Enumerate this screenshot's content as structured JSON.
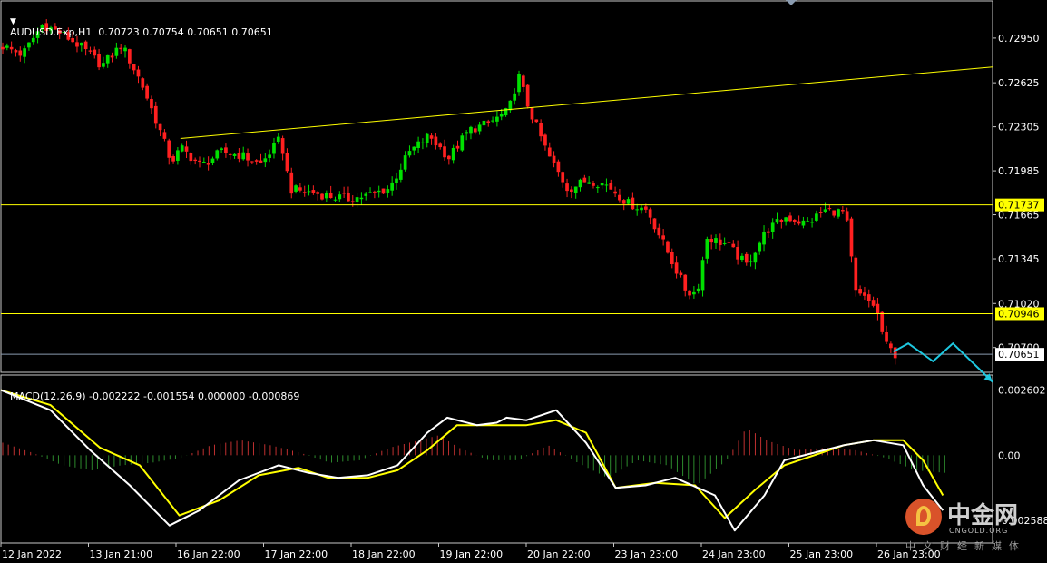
{
  "symbol_header": "AUDUSD.Exp,H1  0.70723 0.70754 0.70651 0.70651",
  "macd_header": "MACD(12,26,9) -0.002222 -0.001554 0.000000 -0.000869",
  "watermark": {
    "name": "中金网",
    "domain": "CNGOLD.ORG",
    "sub": "中文财经新媒体"
  },
  "colors": {
    "bull": "#00e000",
    "bear": "#ff2020",
    "trendline": "#ffff00",
    "forecast": "#1ec8e0",
    "macd_main": "#ffffff",
    "macd_signal": "#ffff00",
    "grid": "#cfcfcf",
    "price_line": "#8a9bb0"
  },
  "chart_data": [
    {
      "type": "candlestick",
      "symbol": "AUDUSD.Exp",
      "timeframe": "H1",
      "ohlc": {
        "open": 0.70723,
        "high": 0.70754,
        "low": 0.70651,
        "close": 0.70651
      },
      "ylim": [
        0.7052,
        0.7322
      ],
      "y_ticks": [
        "0.72950",
        "0.72625",
        "0.72305",
        "0.71985",
        "0.71665",
        "0.71345",
        "0.71020",
        "0.70700"
      ],
      "x_ticks": [
        "12 Jan 2022",
        "13 Jan 21:00",
        "16 Jan 22:00",
        "17 Jan 22:00",
        "18 Jan 22:00",
        "19 Jan 22:00",
        "20 Jan 22:00",
        "23 Jan 23:00",
        "24 Jan 23:00",
        "25 Jan 23:00",
        "26 Jan 23:00"
      ],
      "horizontal_levels": [
        {
          "value": 0.71737,
          "label": "0.71737"
        },
        {
          "value": 0.70946,
          "label": "0.70946"
        }
      ],
      "current_price": {
        "value": 0.70651,
        "label": "0.70651"
      },
      "trendline": {
        "from": [
          0.181,
          0.7222
        ],
        "to": [
          1.0,
          0.7274
        ]
      },
      "close_path": [
        [
          0.0,
          0.7289
        ],
        [
          0.02,
          0.7283
        ],
        [
          0.04,
          0.7305
        ],
        [
          0.06,
          0.7298
        ],
        [
          0.08,
          0.7288
        ],
        [
          0.1,
          0.7275
        ],
        [
          0.12,
          0.729
        ],
        [
          0.14,
          0.7262
        ],
        [
          0.16,
          0.7225
        ],
        [
          0.17,
          0.7205
        ],
        [
          0.18,
          0.7215
        ],
        [
          0.2,
          0.7202
        ],
        [
          0.22,
          0.7212
        ],
        [
          0.24,
          0.721
        ],
        [
          0.26,
          0.7203
        ],
        [
          0.28,
          0.7222
        ],
        [
          0.29,
          0.7185
        ],
        [
          0.31,
          0.7183
        ],
        [
          0.33,
          0.718
        ],
        [
          0.35,
          0.7178
        ],
        [
          0.37,
          0.7181
        ],
        [
          0.39,
          0.7186
        ],
        [
          0.41,
          0.7212
        ],
        [
          0.43,
          0.7224
        ],
        [
          0.45,
          0.7208
        ],
        [
          0.47,
          0.7228
        ],
        [
          0.49,
          0.7233
        ],
        [
          0.51,
          0.7242
        ],
        [
          0.52,
          0.7268
        ],
        [
          0.53,
          0.7245
        ],
        [
          0.55,
          0.721
        ],
        [
          0.57,
          0.7185
        ],
        [
          0.59,
          0.7192
        ],
        [
          0.61,
          0.7188
        ],
        [
          0.63,
          0.7175
        ],
        [
          0.65,
          0.717
        ],
        [
          0.67,
          0.714
        ],
        [
          0.69,
          0.711
        ],
        [
          0.7,
          0.711
        ],
        [
          0.71,
          0.715
        ],
        [
          0.73,
          0.7145
        ],
        [
          0.75,
          0.713
        ],
        [
          0.77,
          0.7155
        ],
        [
          0.79,
          0.7165
        ],
        [
          0.81,
          0.716
        ],
        [
          0.83,
          0.717
        ],
        [
          0.85,
          0.7168
        ],
        [
          0.86,
          0.711
        ],
        [
          0.88,
          0.71
        ],
        [
          0.89,
          0.7072
        ],
        [
          0.9,
          0.70651
        ]
      ],
      "forecast_path": [
        [
          0.9,
          0.7067
        ],
        [
          0.915,
          0.7073
        ],
        [
          0.94,
          0.706
        ],
        [
          0.96,
          0.7073
        ],
        [
          1.0,
          0.7045
        ]
      ]
    },
    {
      "type": "macd",
      "params": "12,26,9",
      "values": {
        "main": -0.002222,
        "signal": -0.001554,
        "histogram": 0.0,
        "osma": -0.000869
      },
      "ylim": [
        -0.0035,
        0.0032
      ],
      "y_ticks": [
        "0.002602",
        "0.00",
        "-0.002588"
      ],
      "main_path": [
        [
          0.0,
          0.0026
        ],
        [
          0.05,
          0.0018
        ],
        [
          0.09,
          0.0002
        ],
        [
          0.13,
          -0.0012
        ],
        [
          0.17,
          -0.0028
        ],
        [
          0.2,
          -0.0022
        ],
        [
          0.24,
          -0.001
        ],
        [
          0.28,
          -0.0004
        ],
        [
          0.31,
          -0.0007
        ],
        [
          0.34,
          -0.0009
        ],
        [
          0.37,
          -0.0008
        ],
        [
          0.4,
          -0.0004
        ],
        [
          0.43,
          0.0009
        ],
        [
          0.45,
          0.0015
        ],
        [
          0.48,
          0.0012
        ],
        [
          0.5,
          0.0013
        ],
        [
          0.51,
          0.0015
        ],
        [
          0.53,
          0.0014
        ],
        [
          0.56,
          0.0018
        ],
        [
          0.59,
          0.0005
        ],
        [
          0.62,
          -0.0013
        ],
        [
          0.65,
          -0.0012
        ],
        [
          0.68,
          -0.0009
        ],
        [
          0.72,
          -0.0016
        ],
        [
          0.74,
          -0.003
        ],
        [
          0.77,
          -0.0016
        ],
        [
          0.79,
          -0.0002
        ],
        [
          0.82,
          0.0001
        ],
        [
          0.85,
          0.0004
        ],
        [
          0.88,
          0.0006
        ],
        [
          0.91,
          0.0004
        ],
        [
          0.93,
          -0.0012
        ],
        [
          0.95,
          -0.0022
        ]
      ],
      "signal_path": [
        [
          0.0,
          0.0026
        ],
        [
          0.05,
          0.002
        ],
        [
          0.1,
          0.0003
        ],
        [
          0.14,
          -0.0004
        ],
        [
          0.18,
          -0.0024
        ],
        [
          0.22,
          -0.0018
        ],
        [
          0.26,
          -0.0008
        ],
        [
          0.3,
          -0.0005
        ],
        [
          0.33,
          -0.0009
        ],
        [
          0.37,
          -0.0009
        ],
        [
          0.4,
          -0.0006
        ],
        [
          0.43,
          0.0002
        ],
        [
          0.46,
          0.0012
        ],
        [
          0.5,
          0.0012
        ],
        [
          0.53,
          0.0012
        ],
        [
          0.56,
          0.0014
        ],
        [
          0.59,
          0.0009
        ],
        [
          0.62,
          -0.0013
        ],
        [
          0.66,
          -0.0011
        ],
        [
          0.7,
          -0.0012
        ],
        [
          0.73,
          -0.0025
        ],
        [
          0.76,
          -0.0014
        ],
        [
          0.79,
          -0.0004
        ],
        [
          0.82,
          0.0
        ],
        [
          0.85,
          0.0004
        ],
        [
          0.88,
          0.0006
        ],
        [
          0.91,
          0.0006
        ],
        [
          0.93,
          -0.0002
        ],
        [
          0.95,
          -0.0016
        ]
      ],
      "histogram_path": [
        [
          0.0,
          0.0005
        ],
        [
          0.03,
          0.0001
        ],
        [
          0.06,
          -0.0004
        ],
        [
          0.09,
          -0.0006
        ],
        [
          0.12,
          -0.0004
        ],
        [
          0.15,
          -0.0003
        ],
        [
          0.18,
          -0.0001
        ],
        [
          0.21,
          0.0004
        ],
        [
          0.24,
          0.0006
        ],
        [
          0.27,
          0.0004
        ],
        [
          0.3,
          0.0001
        ],
        [
          0.33,
          -0.0003
        ],
        [
          0.36,
          -0.0002
        ],
        [
          0.39,
          0.0003
        ],
        [
          0.42,
          0.0006
        ],
        [
          0.44,
          0.0008
        ],
        [
          0.46,
          0.0003
        ],
        [
          0.49,
          -0.0002
        ],
        [
          0.52,
          -0.0002
        ],
        [
          0.55,
          0.0004
        ],
        [
          0.58,
          -0.0003
        ],
        [
          0.61,
          -0.0009
        ],
        [
          0.64,
          -0.0002
        ],
        [
          0.67,
          -0.0004
        ],
        [
          0.7,
          -0.0012
        ],
        [
          0.73,
          -0.0002
        ],
        [
          0.75,
          0.0011
        ],
        [
          0.77,
          0.0006
        ],
        [
          0.8,
          0.0002
        ],
        [
          0.83,
          0.0003
        ],
        [
          0.86,
          0.0002
        ],
        [
          0.89,
          -0.0001
        ],
        [
          0.92,
          -0.0006
        ],
        [
          0.95,
          -0.0007
        ]
      ]
    }
  ]
}
